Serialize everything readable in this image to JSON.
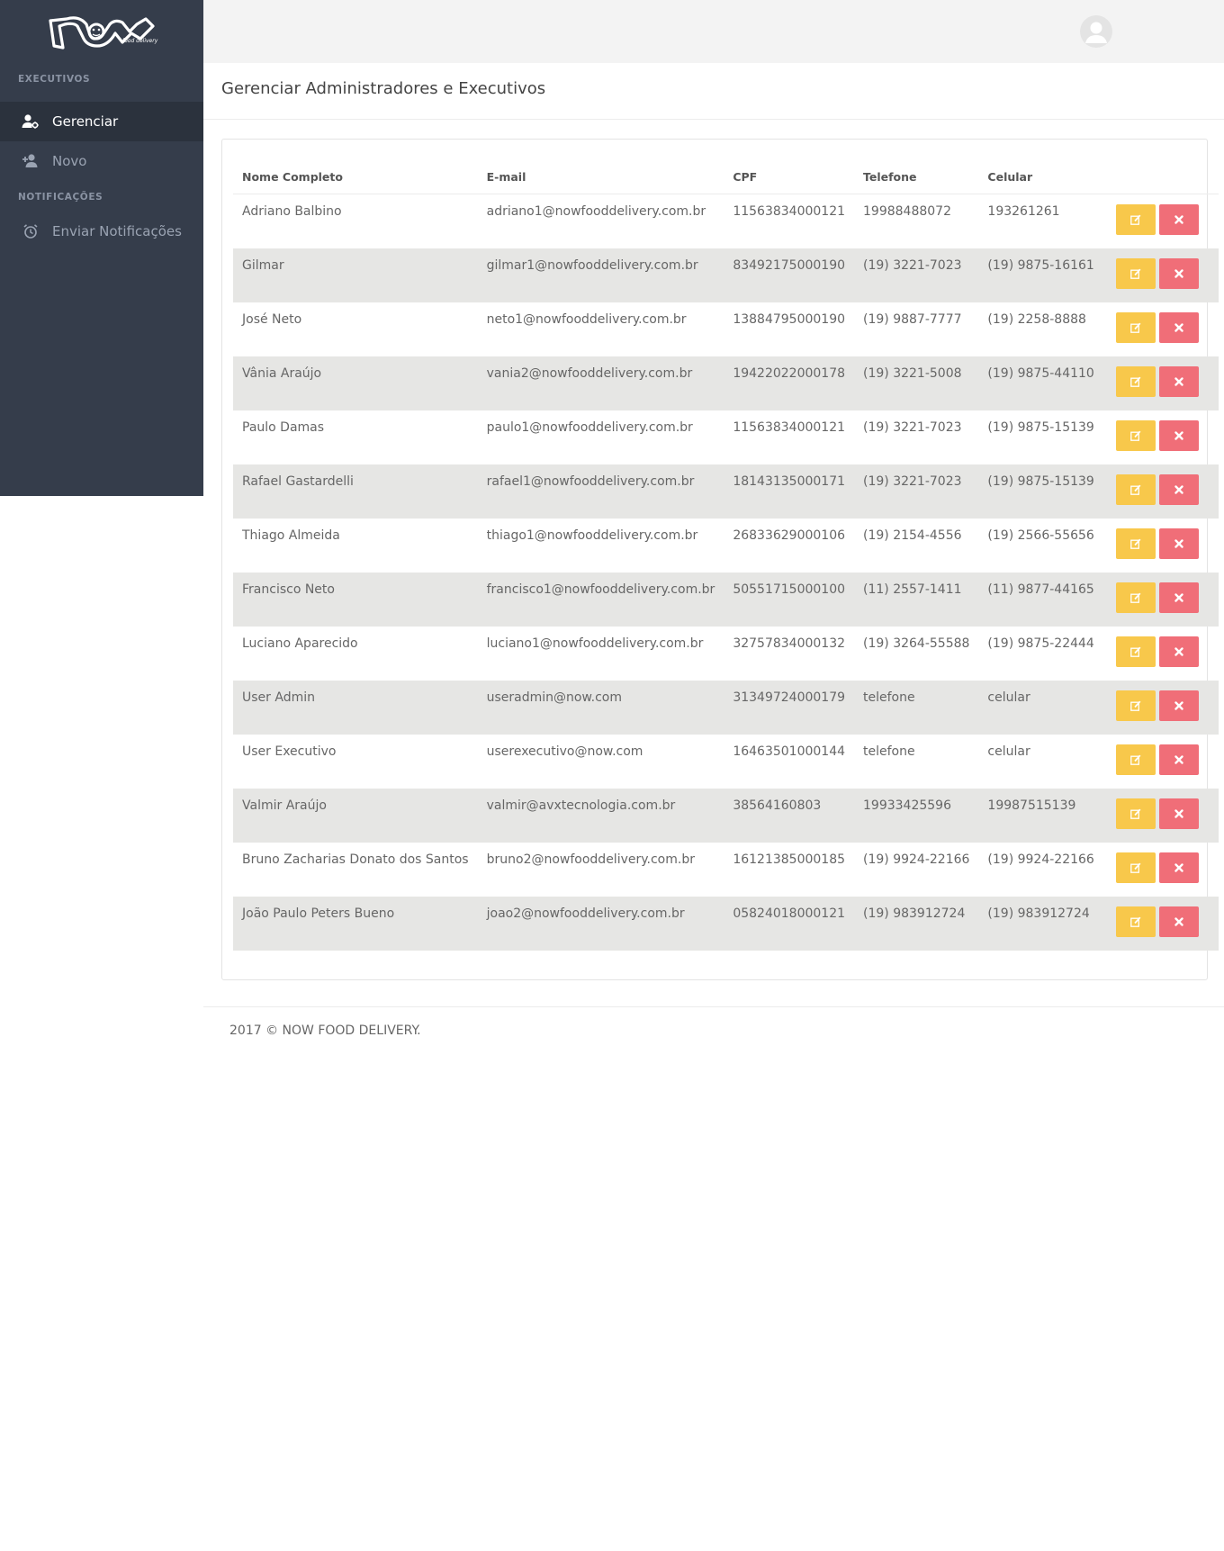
{
  "sidebar": {
    "brand": "now",
    "brand_sub": "food delivery",
    "sections": [
      {
        "title": "EXECUTIVOS",
        "items": [
          {
            "label": "Gerenciar",
            "icon": "user-gear-icon"
          },
          {
            "label": "Novo",
            "icon": "user-plus-icon"
          }
        ]
      },
      {
        "title": "NOTIFICAÇÕES",
        "items": [
          {
            "label": "Enviar Notificações",
            "icon": "alarm-clock-icon"
          }
        ]
      }
    ]
  },
  "topbar": {
    "avatar_icon": "user-avatar-icon"
  },
  "page": {
    "title": "Gerenciar Administradores e Executivos"
  },
  "table": {
    "headers": [
      "Nome Completo",
      "E-mail",
      "CPF",
      "Telefone",
      "Celular"
    ],
    "rows": [
      [
        "Adriano Balbino",
        "adriano1@nowfooddelivery.com.br",
        "11563834000121",
        "19988488072",
        "193261261"
      ],
      [
        "Gilmar",
        "gilmar1@nowfooddelivery.com.br",
        "83492175000190",
        "(19) 3221-7023",
        "(19) 9875-16161"
      ],
      [
        "José Neto",
        "neto1@nowfooddelivery.com.br",
        "13884795000190",
        "(19) 9887-7777",
        "(19) 2258-8888"
      ],
      [
        "Vânia Araújo",
        "vania2@nowfooddelivery.com.br",
        "19422022000178",
        "(19) 3221-5008",
        "(19) 9875-44110"
      ],
      [
        "Paulo Damas",
        "paulo1@nowfooddelivery.com.br",
        "11563834000121",
        "(19) 3221-7023",
        "(19) 9875-15139"
      ],
      [
        "Rafael Gastardelli",
        "rafael1@nowfooddelivery.com.br",
        "18143135000171",
        "(19) 3221-7023",
        "(19) 9875-15139"
      ],
      [
        "Thiago Almeida",
        "thiago1@nowfooddelivery.com.br",
        "26833629000106",
        "(19) 2154-4556",
        "(19) 2566-55656"
      ],
      [
        "Francisco Neto",
        "francisco1@nowfooddelivery.com.br",
        "50551715000100",
        "(11) 2557-1411",
        "(11) 9877-44165"
      ],
      [
        "Luciano Aparecido",
        "luciano1@nowfooddelivery.com.br",
        "32757834000132",
        "(19) 3264-55588",
        "(19) 9875-22444"
      ],
      [
        "User Admin",
        "useradmin@now.com",
        "31349724000179",
        "telefone",
        "celular"
      ],
      [
        "User Executivo",
        "userexecutivo@now.com",
        "16463501000144",
        "telefone",
        "celular"
      ],
      [
        "Valmir Araújo",
        "valmir@avxtecnologia.com.br",
        "38564160803",
        "19933425596",
        "19987515139"
      ],
      [
        "Bruno Zacharias Donato dos Santos",
        "bruno2@nowfooddelivery.com.br",
        "16121385000185",
        "(19) 9924-22166",
        "(19) 9924-22166"
      ],
      [
        "João Paulo Peters Bueno",
        "joao2@nowfooddelivery.com.br",
        "05824018000121",
        "(19) 983912724",
        "(19) 983912724"
      ]
    ],
    "edit_icon": "edit-icon",
    "delete_icon": "close-icon"
  },
  "colors": {
    "sidebar_bg": "#353d4b",
    "edit_button": "#f8c84b",
    "delete_button": "#f06e78",
    "stripe": "#e6e6e4"
  },
  "footer": {
    "text": "2017 © NOW FOOD DELIVERY."
  }
}
